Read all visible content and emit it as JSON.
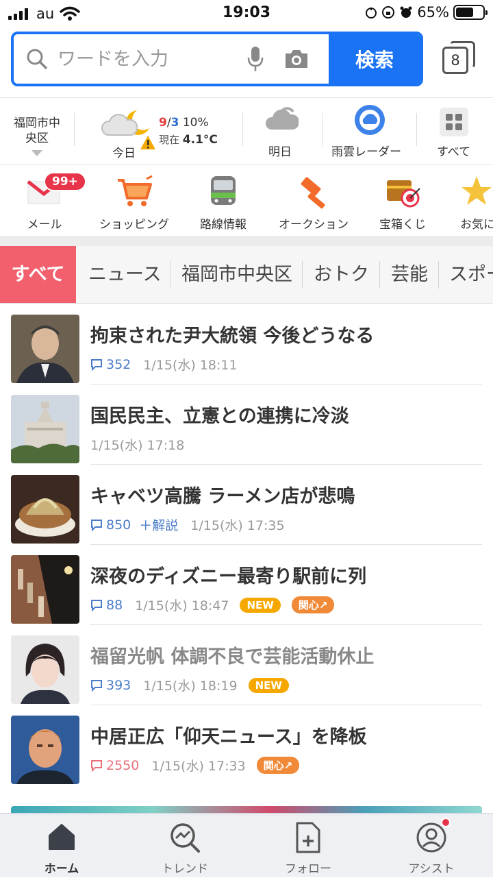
{
  "status_bar": {
    "carrier": "au",
    "time": "19:03",
    "battery": "65%",
    "battery_level": 0.65
  },
  "search": {
    "placeholder": "ワードを入力",
    "button_label": "検索",
    "tab_count": "8"
  },
  "weather": {
    "location": "福岡市中央区",
    "location_line1": "福岡市中",
    "location_line2": "央区",
    "today_label": "今日",
    "high": "9",
    "slash": "/",
    "low": "3",
    "rain_chance": "10%",
    "current_label": "現在",
    "current_temp": "4.1°C",
    "tomorrow_label": "明日",
    "radar_label": "雨雲レーダー",
    "all_label": "すべて"
  },
  "services": [
    {
      "label": "メール",
      "badge": "99+"
    },
    {
      "label": "ショッピング"
    },
    {
      "label": "路線情報"
    },
    {
      "label": "オークション"
    },
    {
      "label": "宝箱くじ"
    },
    {
      "label": "お気に"
    }
  ],
  "categories": [
    "すべて",
    "ニュース",
    "福岡市中央区",
    "おトク",
    "芸能",
    "スポーツ"
  ],
  "news": [
    {
      "title": "拘束された尹大統領 今後どうなる",
      "comments": "352",
      "date": "1/15(水) 18:11"
    },
    {
      "title": "国民民主、立憲との連携に冷淡",
      "date": "1/15(水) 17:18"
    },
    {
      "title": "キャベツ高騰 ラーメン店が悲鳴",
      "comments": "850",
      "extra": "＋解説",
      "date": "1/15(水) 17:35"
    },
    {
      "title": "深夜のディズニー最寄り駅前に列",
      "comments": "88",
      "date": "1/15(水) 18:47",
      "new_badge": "NEW",
      "interest_badge": "関心"
    },
    {
      "title": "福留光帆 体調不良で芸能活動休止",
      "comments": "393",
      "date": "1/15(水) 18:19",
      "new_badge": "NEW"
    },
    {
      "title": "中居正広「仰天ニュース」を降板",
      "comments": "2550",
      "date": "1/15(水) 17:33",
      "interest_badge": "関心"
    }
  ],
  "bottom_nav": [
    {
      "label": "ホーム",
      "icon": "home-icon"
    },
    {
      "label": "トレンド",
      "icon": "trend-icon"
    },
    {
      "label": "フォロー",
      "icon": "follow-icon"
    },
    {
      "label": "アシスト",
      "icon": "assist-icon"
    }
  ],
  "colors": {
    "accent": "#1a73f5",
    "active_tab": "#f25f6d",
    "comment_blue": "#4a7cc7",
    "comment_hot": "#e8707a",
    "new_badge": "#f6a800",
    "interest_badge": "#f08a38"
  }
}
